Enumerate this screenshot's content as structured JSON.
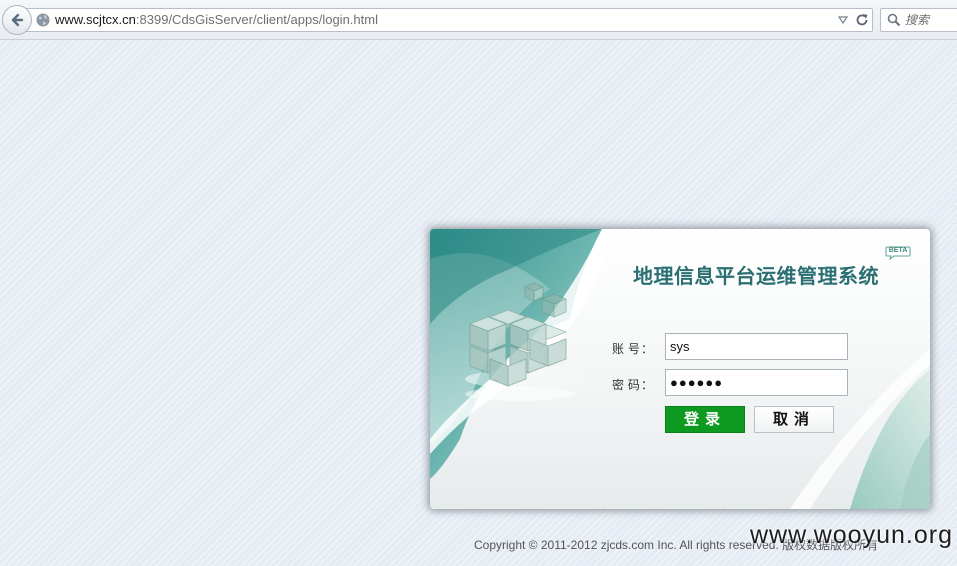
{
  "browser": {
    "url_domain": "www.scjtcx.cn",
    "url_path": ":8399/CdsGisServer/client/apps/login.html",
    "search_placeholder": "搜索"
  },
  "login": {
    "title": "地理信息平台运维管理系统",
    "badge": "BETA",
    "account_label": "账 号",
    "password_label": "密 码",
    "colon": "：",
    "account_value": "sys",
    "password_value": "●●●●●●",
    "login_button": "登录",
    "cancel_button": "取消"
  },
  "footer": {
    "copyright": "Copyright © 2011-2012 zjcds.com Inc. All rights reserved. 版权数据版权所有"
  },
  "watermark": "www.wooyun.org",
  "colors": {
    "login_button": "#0e9a20",
    "title": "#2b6f72",
    "teal_accent": "#4aa3a0"
  }
}
